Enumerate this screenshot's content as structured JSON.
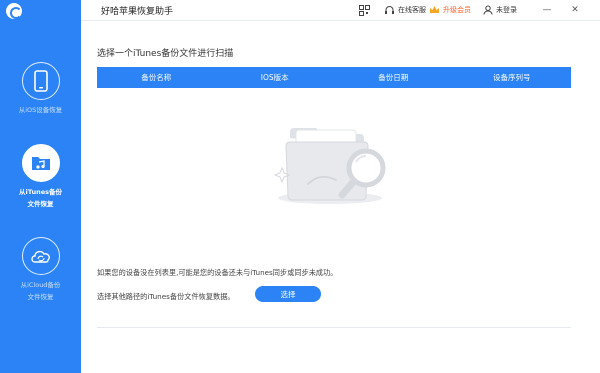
{
  "window": {
    "title": "好哈苹果恢复助手",
    "online_service": "在线客服",
    "upgrade": "升级会员",
    "login": "未登录",
    "minimize_symbol": "—",
    "close_symbol": "✕"
  },
  "sidebar": {
    "items": [
      {
        "label": "从iOS设备恢复",
        "icon": "phone-icon",
        "active": false
      },
      {
        "label_line1": "从iTunes备份",
        "label_line2": "文件恢复",
        "icon": "music-folder-icon",
        "active": true
      },
      {
        "label_line1": "从iCloud备份",
        "label_line2": "文件恢复",
        "icon": "cloud-sync-icon",
        "active": false
      }
    ]
  },
  "main": {
    "title": "选择一个iTunes备份文件进行扫描",
    "table": {
      "columns": [
        "备份名称",
        "IOS版本",
        "备份日期",
        "设备序列号"
      ],
      "rows": []
    },
    "hint_not_found": "如果您的设备没在列表里,可能是您的设备还未与iTunes同步或同步未成功。",
    "hint_other_path": "选择其他路径的iTunes备份文件恢复数据。",
    "select_button": "选择"
  },
  "colors": {
    "accent": "#2b83f6",
    "upgrade": "#ff5a1f",
    "sidebar_bg": "#2b83f6"
  }
}
